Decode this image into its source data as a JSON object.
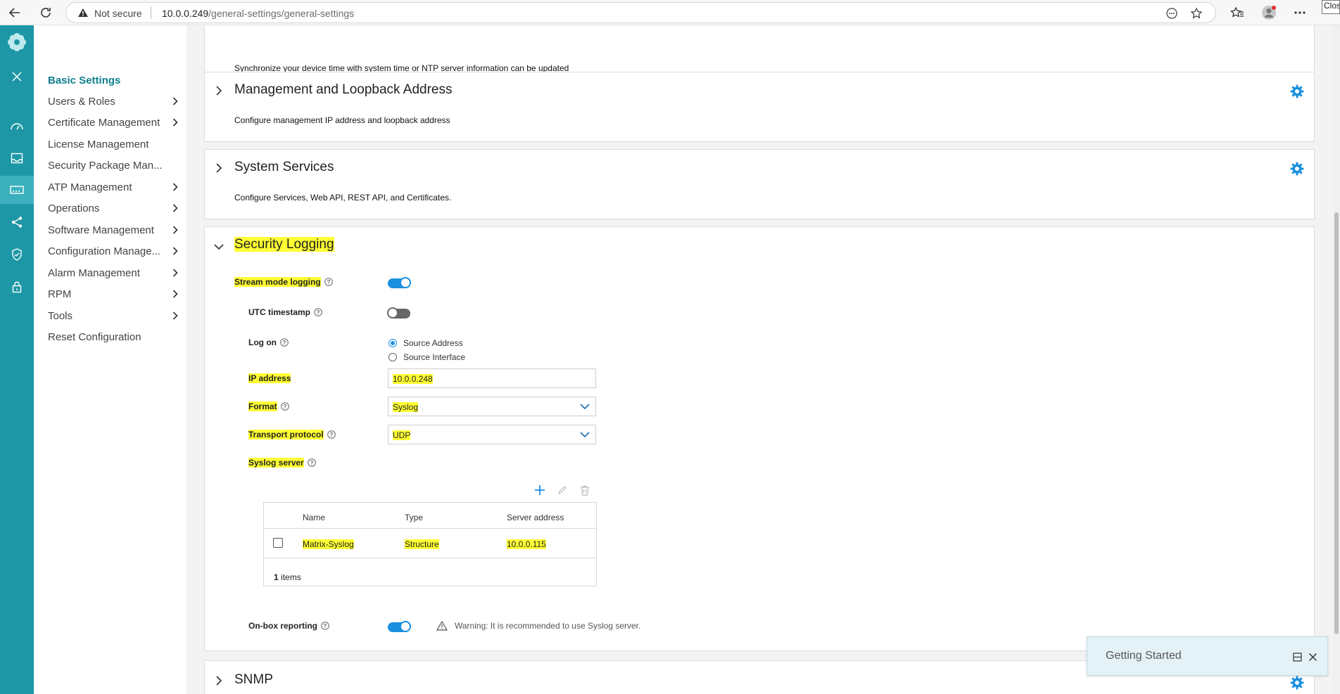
{
  "browser": {
    "security_label": "Not secure",
    "url_host": "10.0.0.249",
    "url_path": "/general-settings/general-settings",
    "tooltip": "Clos"
  },
  "sidenav": {
    "items": [
      {
        "label": "Basic Settings",
        "active": true,
        "chevron": false
      },
      {
        "label": "Users & Roles",
        "chevron": true
      },
      {
        "label": "Certificate Management",
        "chevron": true
      },
      {
        "label": "License Management",
        "chevron": false
      },
      {
        "label": "Security Package Man...",
        "chevron": false
      },
      {
        "label": "ATP Management",
        "chevron": true
      },
      {
        "label": "Operations",
        "chevron": true
      },
      {
        "label": "Software Management",
        "chevron": true
      },
      {
        "label": "Configuration Manage...",
        "chevron": true
      },
      {
        "label": "Alarm Management",
        "chevron": true
      },
      {
        "label": "RPM",
        "chevron": true
      },
      {
        "label": "Tools",
        "chevron": true
      },
      {
        "label": "Reset Configuration",
        "chevron": false
      }
    ]
  },
  "sections": {
    "time": {
      "desc": "Synchronize your device time with system time or NTP server information can be updated"
    },
    "mgmt": {
      "title": "Management and Loopback Address",
      "desc": "Configure management IP address and loopback address"
    },
    "services": {
      "title": "System Services",
      "desc": "Configure Services, Web API, REST API, and Certificates."
    },
    "logging": {
      "title": "Security Logging",
      "stream_mode": {
        "label": "Stream mode logging",
        "on": true
      },
      "utc": {
        "label": "UTC timestamp",
        "on": false
      },
      "log_on": {
        "label": "Log on",
        "options": [
          "Source Address",
          "Source Interface"
        ],
        "selected": "Source Address"
      },
      "ip": {
        "label": "IP address",
        "value": "10.0.0.248"
      },
      "format": {
        "label": "Format",
        "value": "Syslog"
      },
      "transport": {
        "label": "Transport protocol",
        "value": "UDP"
      },
      "syslog": {
        "label": "Syslog server",
        "columns": [
          "Name",
          "Type",
          "Server address"
        ],
        "rows": [
          {
            "name": "Matrix-Syslog",
            "type": "Structure",
            "address": "10.0.0.115"
          }
        ],
        "count_num": "1",
        "count_word": "items"
      },
      "onbox": {
        "label": "On-box reporting",
        "on": true,
        "warning": "Warning: It is recommended to use Syslog server."
      }
    },
    "snmp": {
      "title": "SNMP"
    }
  },
  "getting_started": {
    "title": "Getting Started"
  },
  "colors": {
    "rail": "#1d97a5",
    "accent": "#1a8fe0",
    "highlight": "#ffff33",
    "active_nav": "#0f7f8f"
  }
}
